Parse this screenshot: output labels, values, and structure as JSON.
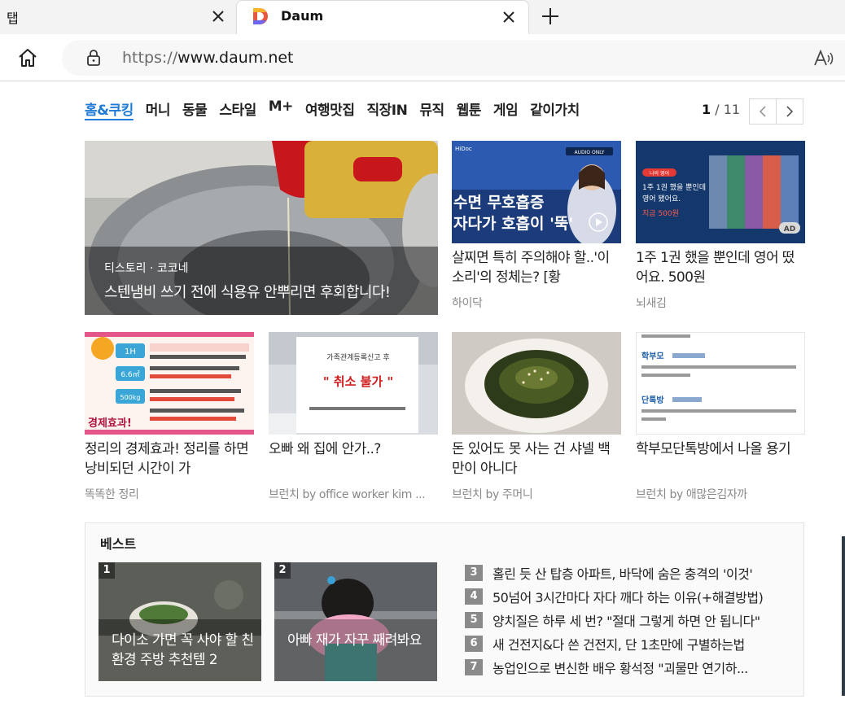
{
  "browser": {
    "prev_tab_title": "탭",
    "active_tab_title": "Daum",
    "url_scheme": "https://",
    "url_rest": "www.daum.net"
  },
  "nav": {
    "categories": [
      "홈&쿠킹",
      "머니",
      "동물",
      "스타일",
      "M+",
      "여행맛집",
      "직장IN",
      "뮤직",
      "웹툰",
      "게임",
      "같이가치"
    ],
    "page_current": "1",
    "page_total": "/ 11"
  },
  "hero": {
    "source": "티스토리 · 코코네",
    "title": "스텐냄비 쓰기 전에 식용유 안뿌리면 후회합니다!"
  },
  "cards": [
    {
      "title": "살찌면 특히 주의해야 할..'이 소리'의 정체는? [황",
      "source": "하이닥",
      "thumb_text": [
        "수면 무호흡증",
        "자다가 호흡이 '뚝'"
      ],
      "badge": "AUDIO ONLY",
      "logo": "HiDoc"
    },
    {
      "title": "1주 1권 했을 뿐인데 영어 떴어요. 500원",
      "source": "뇌새김",
      "thumb_text": [
        "1주 1권 했을 뿐인데",
        "영어 됐어요.",
        "지금 500원"
      ],
      "ad_label": "AD",
      "pill": "나의 영어"
    },
    {
      "title": "정리의 경제효과! 정리를 하면 낭비되던 시간이 가",
      "source": "똑똑한 정리",
      "thumb_text": [
        "1H",
        "6.6㎡",
        "500kg",
        "경제효과!"
      ]
    },
    {
      "title": "오빠 왜 집에 안가..?",
      "source": "브런치 by office worker kim ...",
      "thumb_text": [
        "가족관계등록신고 후",
        "\" 취소 불가 \""
      ]
    },
    {
      "title": "돈 있어도 못 사는 건 샤넬 백만이 아니다",
      "source": "브런치 by 주머니"
    },
    {
      "title": "학부모단톡방에서 나올 용기",
      "source": "브런치 by 애많은김자까",
      "thumb_text": [
        "학부모",
        "단톡방"
      ]
    }
  ],
  "best": {
    "title": "베스트",
    "cards": [
      {
        "rank": "1",
        "title": "다이소 가면 꼭 사야 할 친환경 주방 추천템 2"
      },
      {
        "rank": "2",
        "title": "아빠 재가 자꾸 째려봐요"
      }
    ],
    "list": [
      {
        "rank": "3",
        "text": "홀린 듯 산 탑층 아파트, 바닥에 숨은 충격의 '이것'"
      },
      {
        "rank": "4",
        "text": "50넘어 3시간마다 자다 깨다 하는 이유(+해결방법)"
      },
      {
        "rank": "5",
        "text": "양치질은 하루 세 번? \"절대 그렇게 하면 안 됩니다\""
      },
      {
        "rank": "6",
        "text": "새 건전지&다 쓴 건전지, 단 1초만에 구별하는법"
      },
      {
        "rank": "7",
        "text": "농업인으로 변신한 배우 황석정 \"괴물만 연기하..."
      }
    ]
  },
  "colors": {
    "accent": "#1f7ad8",
    "rank_badge": "#8a8a8a"
  }
}
